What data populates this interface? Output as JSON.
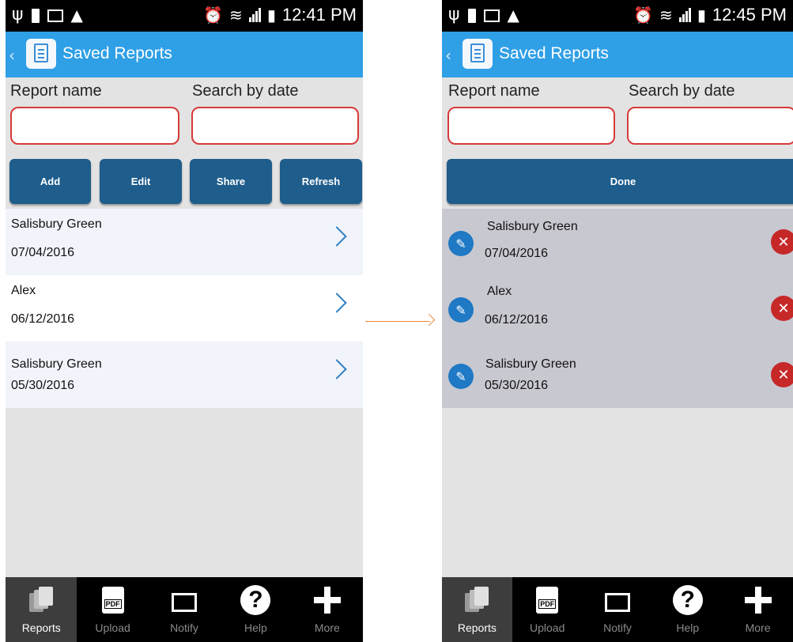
{
  "left": {
    "status": {
      "time": "12:41 PM"
    },
    "title": "Saved Reports",
    "report_name_label": "Report name",
    "search_by_date_label": "Search by date",
    "buttons": [
      "Add",
      "Edit",
      "Share",
      "Refresh"
    ],
    "reports": [
      {
        "name": "Salisbury Green",
        "date": "07/04/2016"
      },
      {
        "name": "Alex",
        "date": "06/12/2016"
      },
      {
        "name": "Salisbury Green",
        "date": "05/30/2016"
      }
    ],
    "nav": [
      "Reports",
      "Upload",
      "Notify",
      "Help",
      "More"
    ]
  },
  "right": {
    "status": {
      "time": "12:45 PM"
    },
    "title": "Saved Reports",
    "report_name_label": "Report name",
    "search_by_date_label": "Search by date",
    "done_label": "Done",
    "reports": [
      {
        "name": "Salisbury Green",
        "date": "07/04/2016"
      },
      {
        "name": "Alex",
        "date": "06/12/2016"
      },
      {
        "name": "Salisbury Green",
        "date": "05/30/2016"
      }
    ],
    "nav": [
      "Reports",
      "Upload",
      "Notify",
      "Help",
      "More"
    ]
  },
  "icons": {
    "pdf_badge": "PDF",
    "help_glyph": "?",
    "back": "chevron-left-icon",
    "row_action": "chevron-right-icon",
    "edit": "pencil-icon",
    "delete": "delete-x-icon"
  },
  "colors": {
    "title_bar": "#2f9fe6",
    "button": "#1e5d8c",
    "input_border": "#d63a3a",
    "edit_circle": "#1f79c4",
    "delete_circle": "#c62828",
    "arrow": "#f0883a"
  }
}
